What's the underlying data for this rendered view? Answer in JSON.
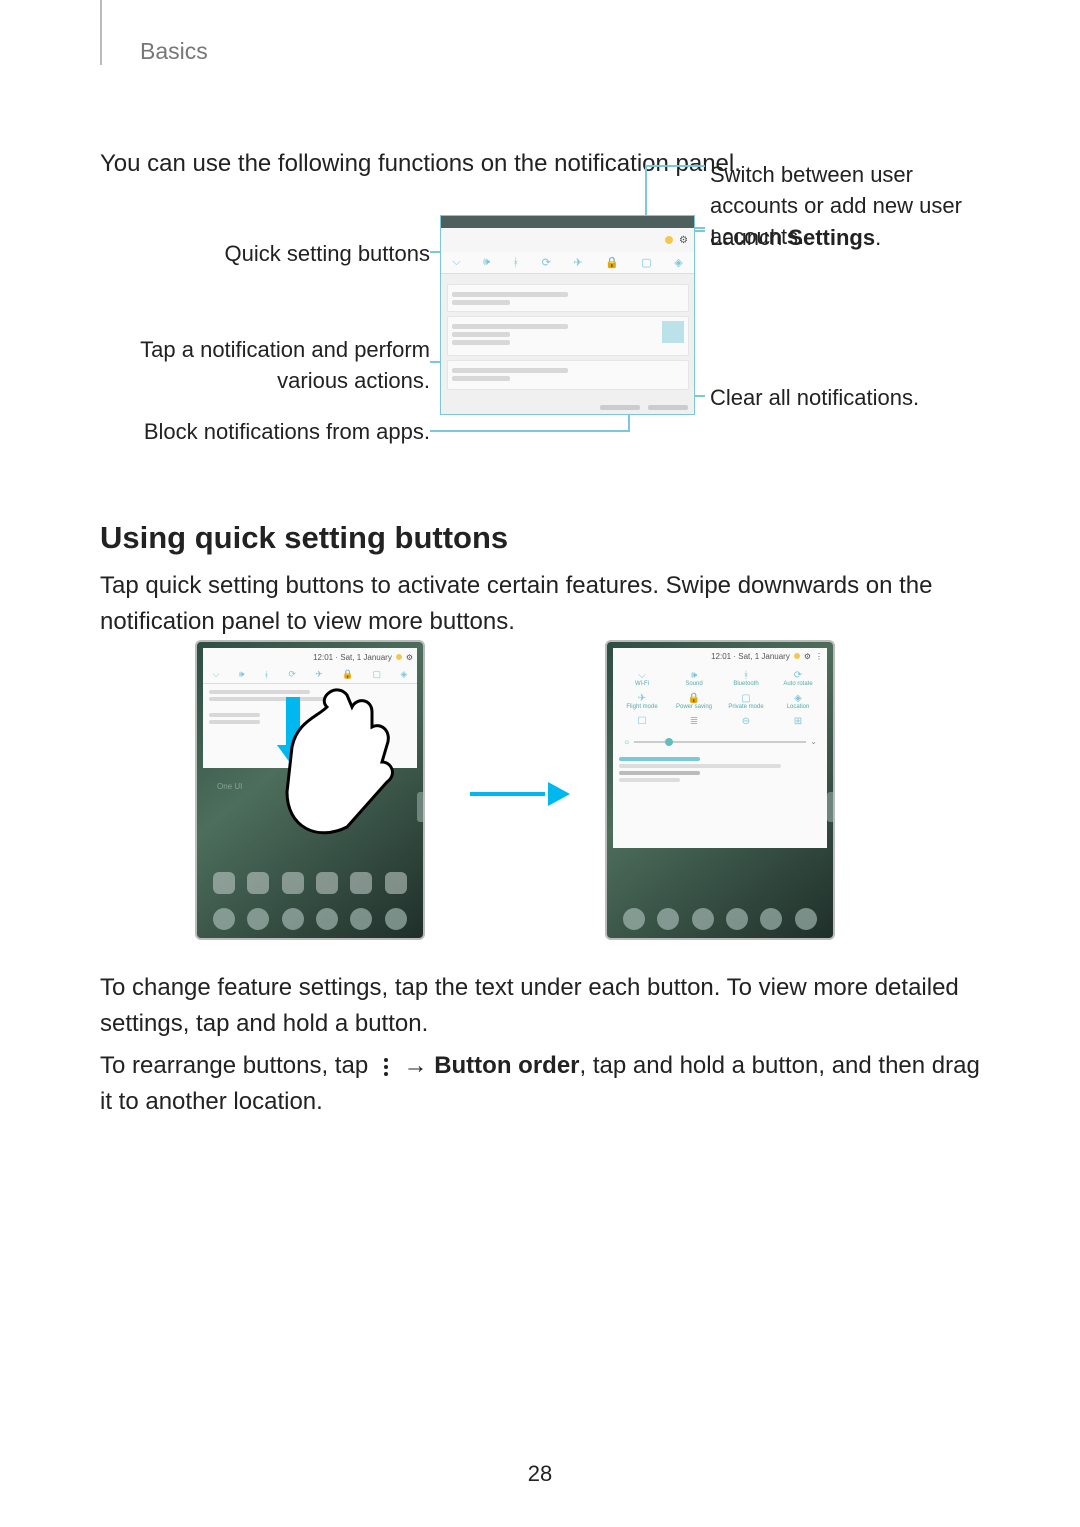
{
  "header": {
    "breadcrumb": "Basics"
  },
  "intro": "You can use the following functions on the notification panel.",
  "callouts": {
    "quick_settings": "Quick setting buttons",
    "tap_notification": "Tap a notification and perform various actions.",
    "block_notifications": "Block notifications from apps.",
    "switch_accounts": "Switch between user accounts or add new user accounts.",
    "launch_prefix": "Launch ",
    "launch_bold": "Settings",
    "launch_suffix": ".",
    "clear_all": "Clear all notifications."
  },
  "section_heading": "Using quick setting buttons",
  "para_swipe": "Tap quick setting buttons to activate certain features. Swipe downwards on the notification panel to view more buttons.",
  "para_change": "To change feature settings, tap the text under each button. To view more detailed settings, tap and hold a button.",
  "para_reorder_prefix": "To rearrange buttons, tap ",
  "para_reorder_arrow": " → ",
  "para_reorder_bold": "Button order",
  "para_reorder_suffix": ", tap and hold a button, and then drag it to another location.",
  "qs_grid_labels": [
    "Wi-Fi",
    "Sound",
    "Bluetooth",
    "Auto rotate",
    "Flight mode",
    "Power saving",
    "Private mode",
    "Location",
    "",
    "",
    "",
    ""
  ],
  "page_number": "28"
}
